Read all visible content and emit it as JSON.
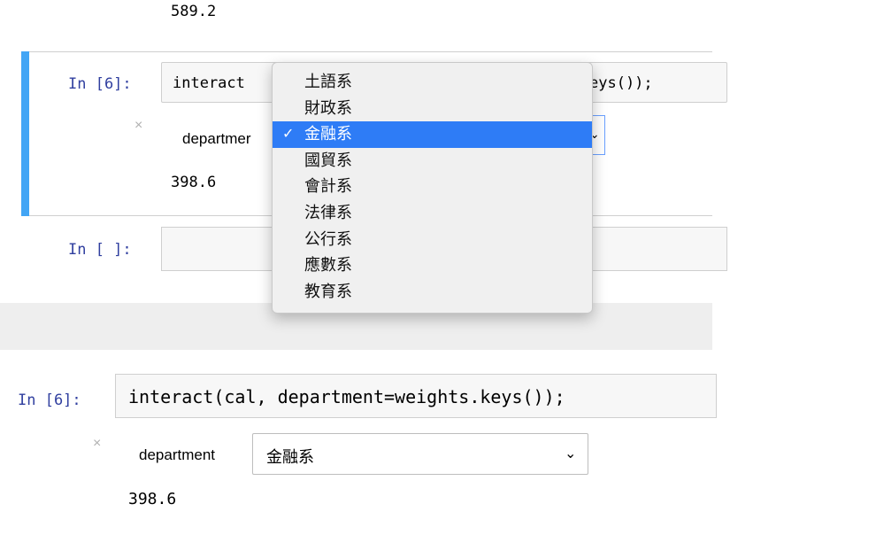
{
  "top_output": "589.2",
  "upper_cell": {
    "prompt": "In [6]:",
    "code_left": "interact",
    "code_right": "eys());",
    "close_glyph": "×",
    "widget_label": "departmer",
    "output": "398.6"
  },
  "empty_cell": {
    "prompt": "In [ ]:"
  },
  "dropdown": {
    "options": [
      "土語系",
      "財政系",
      "金融系",
      "國貿系",
      "會計系",
      "法律系",
      "公行系",
      "應數系",
      "教育系"
    ],
    "selected": "金融系",
    "check_icon": "✓"
  },
  "lower_cell": {
    "prompt": "In [6]:",
    "code": "interact(cal, department=weights.keys());",
    "close_glyph": "×",
    "widget_label": "department",
    "widget_value": "金融系",
    "chevron_icon": "⌄",
    "output": "398.6"
  },
  "colors": {
    "accent": "#42a5f5",
    "selection": "#2e7cf6",
    "prompt": "#303f9f"
  }
}
